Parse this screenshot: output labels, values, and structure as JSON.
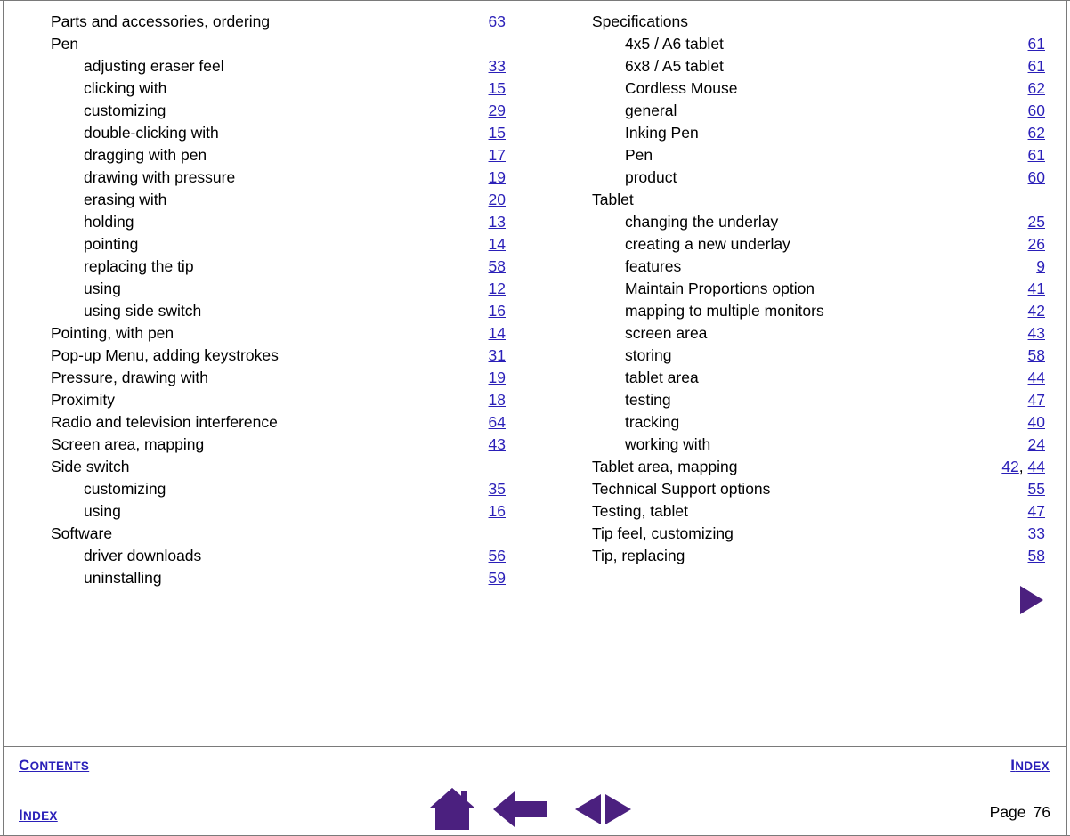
{
  "document": {
    "type": "index-page",
    "page_label": "Page",
    "page_number": "76"
  },
  "colors": {
    "link": "#2a1fb8",
    "icon": "#4b207f",
    "text": "#000000",
    "rule": "#7a7a7a"
  },
  "index": {
    "left_column": [
      {
        "level": 1,
        "label": "Parts and accessories, ordering",
        "pages": [
          "63"
        ]
      },
      {
        "level": 1,
        "label": "Pen",
        "pages": []
      },
      {
        "level": 2,
        "label": "adjusting eraser feel",
        "pages": [
          "33"
        ]
      },
      {
        "level": 2,
        "label": "clicking with",
        "pages": [
          "15"
        ]
      },
      {
        "level": 2,
        "label": "customizing",
        "pages": [
          "29"
        ]
      },
      {
        "level": 2,
        "label": "double-clicking with",
        "pages": [
          "15"
        ]
      },
      {
        "level": 2,
        "label": "dragging with pen",
        "pages": [
          "17"
        ]
      },
      {
        "level": 2,
        "label": "drawing with pressure",
        "pages": [
          "19"
        ]
      },
      {
        "level": 2,
        "label": "erasing with",
        "pages": [
          "20"
        ]
      },
      {
        "level": 2,
        "label": "holding",
        "pages": [
          "13"
        ]
      },
      {
        "level": 2,
        "label": "pointing",
        "pages": [
          "14"
        ]
      },
      {
        "level": 2,
        "label": "replacing the tip",
        "pages": [
          "58"
        ]
      },
      {
        "level": 2,
        "label": "using",
        "pages": [
          "12"
        ]
      },
      {
        "level": 2,
        "label": "using side switch",
        "pages": [
          "16"
        ]
      },
      {
        "level": 1,
        "label": "Pointing, with pen",
        "pages": [
          "14"
        ]
      },
      {
        "level": 1,
        "label": "Pop-up Menu, adding keystrokes",
        "pages": [
          "31"
        ]
      },
      {
        "level": 1,
        "label": "Pressure, drawing with",
        "pages": [
          "19"
        ]
      },
      {
        "level": 1,
        "label": "Proximity",
        "pages": [
          "18"
        ]
      },
      {
        "level": 1,
        "label": "Radio and television interference",
        "pages": [
          "64"
        ]
      },
      {
        "level": 1,
        "label": "Screen area, mapping",
        "pages": [
          "43"
        ]
      },
      {
        "level": 1,
        "label": "Side switch",
        "pages": []
      },
      {
        "level": 2,
        "label": "customizing",
        "pages": [
          "35"
        ]
      },
      {
        "level": 2,
        "label": "using",
        "pages": [
          "16"
        ]
      },
      {
        "level": 1,
        "label": "Software",
        "pages": []
      },
      {
        "level": 2,
        "label": "driver downloads",
        "pages": [
          "56"
        ]
      },
      {
        "level": 2,
        "label": "uninstalling",
        "pages": [
          "59"
        ]
      }
    ],
    "right_column": [
      {
        "level": 1,
        "label": "Specifications",
        "pages": []
      },
      {
        "level": 2,
        "label": "4x5 / A6 tablet",
        "pages": [
          "61"
        ]
      },
      {
        "level": 2,
        "label": "6x8 / A5 tablet",
        "pages": [
          "61"
        ]
      },
      {
        "level": 2,
        "label": "Cordless Mouse",
        "pages": [
          "62"
        ]
      },
      {
        "level": 2,
        "label": "general",
        "pages": [
          "60"
        ]
      },
      {
        "level": 2,
        "label": "Inking Pen",
        "pages": [
          "62"
        ]
      },
      {
        "level": 2,
        "label": "Pen",
        "pages": [
          "61"
        ]
      },
      {
        "level": 2,
        "label": "product",
        "pages": [
          "60"
        ]
      },
      {
        "level": 1,
        "label": "Tablet",
        "pages": []
      },
      {
        "level": 2,
        "label": "changing the underlay",
        "pages": [
          "25"
        ]
      },
      {
        "level": 2,
        "label": "creating a new underlay",
        "pages": [
          "26"
        ]
      },
      {
        "level": 2,
        "label": "features",
        "pages": [
          "9"
        ]
      },
      {
        "level": 2,
        "label": "Maintain Proportions option",
        "pages": [
          "41"
        ]
      },
      {
        "level": 2,
        "label": "mapping to multiple monitors",
        "pages": [
          "42"
        ]
      },
      {
        "level": 2,
        "label": "screen area",
        "pages": [
          "43"
        ]
      },
      {
        "level": 2,
        "label": "storing",
        "pages": [
          "58"
        ]
      },
      {
        "level": 2,
        "label": "tablet area",
        "pages": [
          "44"
        ]
      },
      {
        "level": 2,
        "label": "testing",
        "pages": [
          "47"
        ]
      },
      {
        "level": 2,
        "label": "tracking",
        "pages": [
          "40"
        ]
      },
      {
        "level": 2,
        "label": "working with",
        "pages": [
          "24"
        ]
      },
      {
        "level": 1,
        "label": "Tablet area, mapping",
        "pages": [
          "42",
          "44"
        ]
      },
      {
        "level": 1,
        "label": "Technical Support options",
        "pages": [
          "55"
        ]
      },
      {
        "level": 1,
        "label": "Testing, tablet",
        "pages": [
          "47"
        ]
      },
      {
        "level": 1,
        "label": "Tip feel, customizing",
        "pages": [
          "33"
        ]
      },
      {
        "level": 1,
        "label": "Tip, replacing",
        "pages": [
          "58"
        ]
      }
    ]
  },
  "footer": {
    "contents_link": {
      "first": "C",
      "rest": "ONTENTS"
    },
    "index_link_bottom_left": {
      "first": "I",
      "rest": "NDEX"
    },
    "index_link_top_right": {
      "first": "I",
      "rest": "NDEX"
    },
    "nav_icons": [
      {
        "name": "home-icon",
        "title": "Home"
      },
      {
        "name": "back-arrow-icon",
        "title": "Go back"
      },
      {
        "name": "previous-next-page-icon",
        "title": "Previous / Next page"
      }
    ],
    "continuation_marker": {
      "name": "next-page-triangle-icon"
    }
  }
}
